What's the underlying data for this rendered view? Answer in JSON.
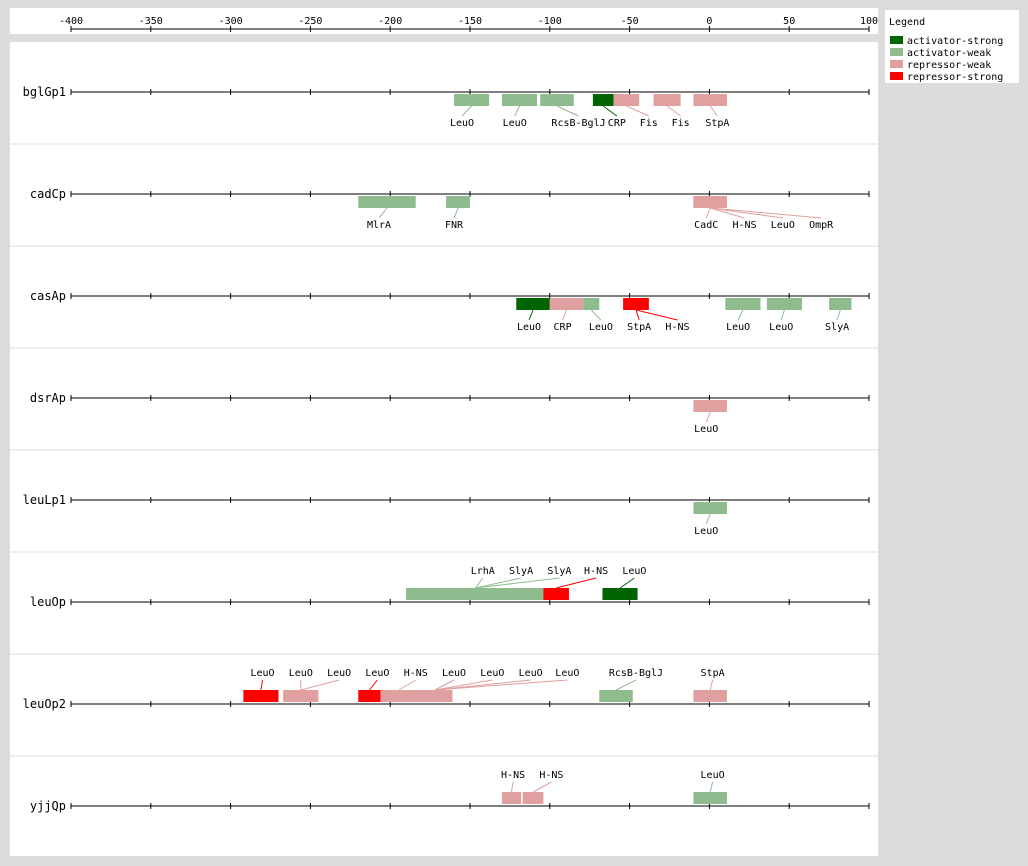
{
  "axis": {
    "min": -400,
    "max": 100,
    "tick_labels": [
      "-400",
      "-350",
      "-300",
      "-250",
      "-200",
      "-150",
      "-100",
      "-50",
      "0",
      "50",
      "100"
    ],
    "tick_values": [
      -400,
      -350,
      -300,
      -250,
      -200,
      -150,
      -100,
      -50,
      0,
      50,
      100
    ]
  },
  "legend": {
    "title": "Legend",
    "items": [
      {
        "key": "activator-strong",
        "label": "activator-strong",
        "color": "#006400"
      },
      {
        "key": "activator-weak",
        "label": "activator-weak",
        "color": "#8fbc8f"
      },
      {
        "key": "repressor-weak",
        "label": "repressor-weak",
        "color": "#e0a0a0"
      },
      {
        "key": "repressor-strong",
        "label": "repressor-strong",
        "color": "#ff0000"
      }
    ]
  },
  "chart_data": {
    "type": "diagram",
    "x_range": [
      -400,
      100
    ],
    "tracks": [
      {
        "promoter": "bglGp1",
        "sites": [
          {
            "name": "LeuO",
            "start": -160,
            "end": -138,
            "type": "activator-weak",
            "label_pos": -155,
            "side": "below"
          },
          {
            "name": "LeuO",
            "start": -130,
            "end": -108,
            "type": "activator-weak",
            "label_pos": -122,
            "side": "below"
          },
          {
            "name": "RcsB-BglJ",
            "start": -106,
            "end": -85,
            "type": "activator-weak",
            "label_pos": -82,
            "side": "below"
          },
          {
            "name": "CRP",
            "start": -73,
            "end": -60,
            "type": "activator-strong",
            "label_pos": -58,
            "side": "below"
          },
          {
            "name": "Fis",
            "start": -60,
            "end": -44,
            "type": "repressor-weak",
            "label_pos": -38,
            "side": "below"
          },
          {
            "name": "Fis",
            "start": -35,
            "end": -18,
            "type": "repressor-weak",
            "label_pos": -18,
            "side": "below"
          },
          {
            "name": "StpA",
            "start": -10,
            "end": 11,
            "type": "repressor-weak",
            "label_pos": 5,
            "side": "below"
          }
        ]
      },
      {
        "promoter": "cadCp",
        "sites": [
          {
            "name": "MlrA",
            "start": -220,
            "end": -184,
            "type": "activator-weak",
            "label_pos": -207,
            "side": "below"
          },
          {
            "name": "FNR",
            "start": -165,
            "end": -150,
            "type": "activator-weak",
            "label_pos": -160,
            "side": "below"
          },
          {
            "name": "CadC",
            "start": -10,
            "end": 11,
            "type": "repressor-weak",
            "label_pos": -2,
            "side": "below"
          },
          {
            "name": "H-NS",
            "start": -10,
            "end": 11,
            "type": "repressor-weak",
            "label_pos": 22,
            "side": "below"
          },
          {
            "name": "LeuO",
            "start": -10,
            "end": 11,
            "type": "repressor-weak",
            "label_pos": 46,
            "side": "below"
          },
          {
            "name": "OmpR",
            "start": -10,
            "end": 11,
            "type": "repressor-weak",
            "label_pos": 70,
            "side": "below"
          }
        ]
      },
      {
        "promoter": "casAp",
        "sites": [
          {
            "name": "LeuO",
            "start": -121,
            "end": -100,
            "type": "activator-strong",
            "label_pos": -113,
            "side": "below"
          },
          {
            "name": "CRP",
            "start": -100,
            "end": -79,
            "type": "repressor-weak",
            "label_pos": -92,
            "side": "below"
          },
          {
            "name": "LeuO",
            "start": -79,
            "end": -69,
            "type": "activator-weak",
            "label_pos": -68,
            "side": "below"
          },
          {
            "name": "StpA",
            "start": -54,
            "end": -38,
            "type": "repressor-strong",
            "label_pos": -44,
            "side": "below"
          },
          {
            "name": "H-NS",
            "start": -54,
            "end": -38,
            "type": "repressor-strong",
            "label_pos": -20,
            "side": "below"
          },
          {
            "name": "LeuO",
            "start": 10,
            "end": 32,
            "type": "activator-weak",
            "label_pos": 18,
            "side": "below"
          },
          {
            "name": "LeuO",
            "start": 36,
            "end": 58,
            "type": "activator-weak",
            "label_pos": 45,
            "side": "below"
          },
          {
            "name": "SlyA",
            "start": 75,
            "end": 89,
            "type": "activator-weak",
            "label_pos": 80,
            "side": "below"
          }
        ]
      },
      {
        "promoter": "dsrAp",
        "sites": [
          {
            "name": "LeuO",
            "start": -10,
            "end": 11,
            "type": "repressor-weak",
            "label_pos": -2,
            "side": "below"
          }
        ]
      },
      {
        "promoter": "leuLp1",
        "sites": [
          {
            "name": "LeuO",
            "start": -10,
            "end": 11,
            "type": "activator-weak",
            "label_pos": -2,
            "side": "below"
          }
        ]
      },
      {
        "promoter": "leuOp",
        "sites": [
          {
            "name": "LrhA",
            "start": -190,
            "end": -103,
            "type": "activator-weak",
            "label_pos": -142,
            "side": "above"
          },
          {
            "name": "SlyA",
            "start": -190,
            "end": -103,
            "type": "activator-weak",
            "label_pos": -118,
            "side": "above"
          },
          {
            "name": "SlyA",
            "start": -190,
            "end": -103,
            "type": "activator-weak",
            "label_pos": -94,
            "side": "above"
          },
          {
            "name": "H-NS",
            "start": -104,
            "end": -88,
            "type": "repressor-strong",
            "label_pos": -71,
            "side": "above"
          },
          {
            "name": "LeuO",
            "start": -67,
            "end": -45,
            "type": "activator-strong",
            "label_pos": -47,
            "side": "above"
          }
        ]
      },
      {
        "promoter": "leuOp2",
        "sites": [
          {
            "name": "LeuO",
            "start": -292,
            "end": -270,
            "type": "repressor-strong",
            "label_pos": -280,
            "side": "above"
          },
          {
            "name": "LeuO",
            "start": -267,
            "end": -245,
            "type": "repressor-weak",
            "label_pos": -256,
            "side": "above"
          },
          {
            "name": "LeuO",
            "start": -267,
            "end": -245,
            "type": "repressor-weak",
            "label_pos": -232,
            "side": "above"
          },
          {
            "name": "LeuO",
            "start": -220,
            "end": -206,
            "type": "repressor-strong",
            "label_pos": -208,
            "side": "above"
          },
          {
            "name": "H-NS",
            "start": -206,
            "end": -183,
            "type": "repressor-weak",
            "label_pos": -184,
            "side": "above"
          },
          {
            "name": "LeuO",
            "start": -183,
            "end": -161,
            "type": "repressor-weak",
            "label_pos": -160,
            "side": "above"
          },
          {
            "name": "LeuO",
            "start": -183,
            "end": -161,
            "type": "repressor-weak",
            "label_pos": -136,
            "side": "above"
          },
          {
            "name": "LeuO",
            "start": -183,
            "end": -161,
            "type": "repressor-weak",
            "label_pos": -112,
            "side": "above"
          },
          {
            "name": "LeuO",
            "start": -183,
            "end": -161,
            "type": "repressor-weak",
            "label_pos": -89,
            "side": "above"
          },
          {
            "name": "RcsB-BglJ",
            "start": -69,
            "end": -48,
            "type": "activator-weak",
            "label_pos": -46,
            "side": "above"
          },
          {
            "name": "StpA",
            "start": -10,
            "end": 11,
            "type": "repressor-weak",
            "label_pos": 2,
            "side": "above"
          }
        ]
      },
      {
        "promoter": "yjjQp",
        "sites": [
          {
            "name": "H-NS",
            "start": -130,
            "end": -118,
            "type": "repressor-weak",
            "label_pos": -123,
            "side": "above"
          },
          {
            "name": "H-NS",
            "start": -117,
            "end": -104,
            "type": "repressor-weak",
            "label_pos": -99,
            "side": "above"
          },
          {
            "name": "LeuO",
            "start": -10,
            "end": 11,
            "type": "activator-weak",
            "label_pos": 2,
            "side": "above"
          }
        ]
      }
    ]
  }
}
